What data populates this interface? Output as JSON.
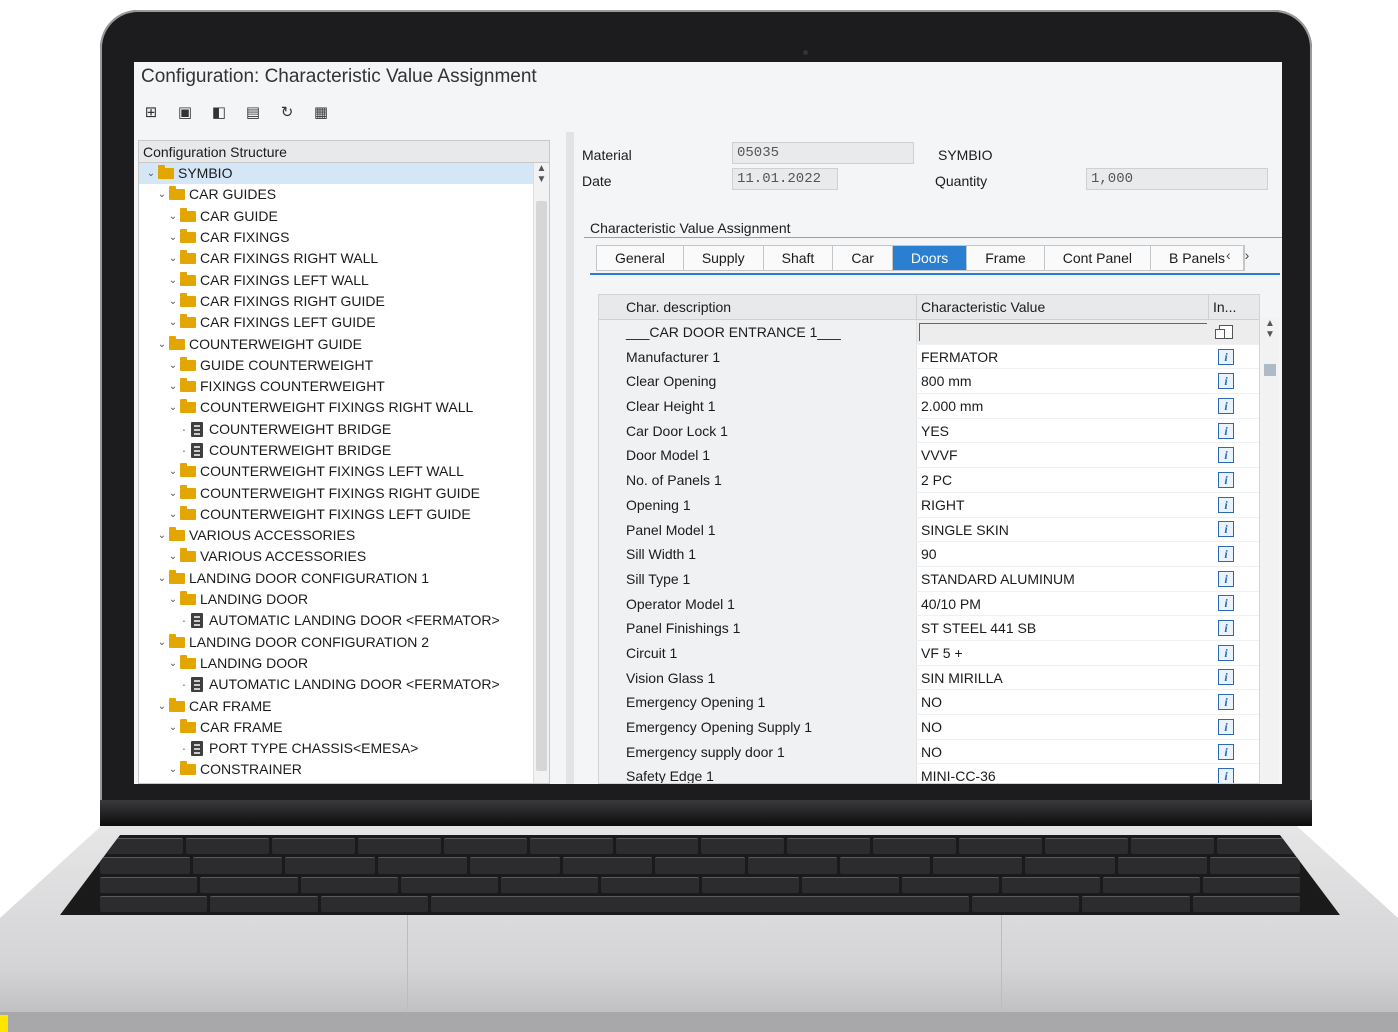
{
  "window": {
    "title": "Configuration: Characteristic Value Assignment"
  },
  "toolbar": {
    "buttons": [
      {
        "name": "tree-view-icon",
        "glyph": "⊞"
      },
      {
        "name": "save-config-icon",
        "glyph": "▣"
      },
      {
        "name": "copy-object-icon",
        "glyph": "◧"
      },
      {
        "name": "price-icon",
        "glyph": "▤"
      },
      {
        "name": "undo-icon",
        "glyph": "↻"
      },
      {
        "name": "calculator-icon",
        "glyph": "▦"
      }
    ]
  },
  "tree": {
    "header": "Configuration Structure",
    "nodes": [
      {
        "label": "SYMBIO",
        "level": 0,
        "type": "folder",
        "selected": true
      },
      {
        "label": "CAR GUIDES",
        "level": 1,
        "type": "folder"
      },
      {
        "label": "CAR GUIDE",
        "level": 2,
        "type": "folder"
      },
      {
        "label": "CAR FIXINGS",
        "level": 2,
        "type": "folder"
      },
      {
        "label": "CAR FIXINGS RIGHT WALL",
        "level": 2,
        "type": "folder"
      },
      {
        "label": "CAR FIXINGS LEFT WALL",
        "level": 2,
        "type": "folder"
      },
      {
        "label": "CAR FIXINGS RIGHT GUIDE",
        "level": 2,
        "type": "folder"
      },
      {
        "label": "CAR FIXINGS LEFT GUIDE",
        "level": 2,
        "type": "folder"
      },
      {
        "label": "COUNTERWEIGHT GUIDE",
        "level": 1,
        "type": "folder"
      },
      {
        "label": "GUIDE COUNTERWEIGHT",
        "level": 2,
        "type": "folder"
      },
      {
        "label": "FIXINGS COUNTERWEIGHT",
        "level": 2,
        "type": "folder"
      },
      {
        "label": "COUNTERWEIGHT FIXINGS RIGHT WALL",
        "level": 2,
        "type": "folder"
      },
      {
        "label": "COUNTERWEIGHT BRIDGE",
        "level": 3,
        "type": "item"
      },
      {
        "label": "COUNTERWEIGHT BRIDGE",
        "level": 3,
        "type": "item"
      },
      {
        "label": "COUNTERWEIGHT FIXINGS LEFT WALL",
        "level": 2,
        "type": "folder"
      },
      {
        "label": "COUNTERWEIGHT FIXINGS RIGHT GUIDE",
        "level": 2,
        "type": "folder"
      },
      {
        "label": "COUNTERWEIGHT FIXINGS LEFT GUIDE",
        "level": 2,
        "type": "folder"
      },
      {
        "label": "VARIOUS ACCESSORIES",
        "level": 1,
        "type": "folder"
      },
      {
        "label": "VARIOUS ACCESSORIES",
        "level": 2,
        "type": "folder"
      },
      {
        "label": "LANDING DOOR CONFIGURATION 1",
        "level": 1,
        "type": "folder"
      },
      {
        "label": "LANDING DOOR",
        "level": 2,
        "type": "folder"
      },
      {
        "label": "AUTOMATIC LANDING DOOR <FERMATOR>",
        "level": 3,
        "type": "item"
      },
      {
        "label": "LANDING DOOR CONFIGURATION 2",
        "level": 1,
        "type": "folder"
      },
      {
        "label": "LANDING DOOR",
        "level": 2,
        "type": "folder"
      },
      {
        "label": "AUTOMATIC LANDING DOOR <FERMATOR>",
        "level": 3,
        "type": "item"
      },
      {
        "label": "CAR FRAME",
        "level": 1,
        "type": "folder"
      },
      {
        "label": "CAR FRAME",
        "level": 2,
        "type": "folder"
      },
      {
        "label": "PORT TYPE CHASSIS<EMESA>",
        "level": 3,
        "type": "item"
      },
      {
        "label": "CONSTRAINER",
        "level": 2,
        "type": "folder"
      }
    ]
  },
  "header": {
    "material_label": "Material",
    "material_value": "05035",
    "material_desc": "SYMBIO",
    "date_label": "Date",
    "date_value": "11.01.2022",
    "quantity_label": "Quantity",
    "quantity_value": "1,000"
  },
  "assignment": {
    "title": "Characteristic Value Assignment",
    "tabs": [
      {
        "label": "General"
      },
      {
        "label": "Supply"
      },
      {
        "label": "Shaft"
      },
      {
        "label": "Car"
      },
      {
        "label": "Doors",
        "active": true
      },
      {
        "label": "Frame"
      },
      {
        "label": "Cont Panel"
      },
      {
        "label": "B Panels"
      }
    ],
    "columns": {
      "desc": "Char. description",
      "value": "Characteristic Value",
      "info": "In..."
    },
    "rows": [
      {
        "desc": "___CAR DOOR ENTRANCE 1___",
        "value": "",
        "separator": true
      },
      {
        "desc": "Manufacturer 1",
        "value": "FERMATOR"
      },
      {
        "desc": "Clear Opening",
        "value": "800 mm"
      },
      {
        "desc": "Clear Height 1",
        "value": "2.000 mm"
      },
      {
        "desc": "Car Door Lock 1",
        "value": "YES"
      },
      {
        "desc": "Door Model 1",
        "value": "VVVF"
      },
      {
        "desc": "No. of Panels 1",
        "value": "2 PC"
      },
      {
        "desc": "Opening 1",
        "value": "RIGHT"
      },
      {
        "desc": "Panel Model 1",
        "value": "SINGLE SKIN"
      },
      {
        "desc": "Sill Width 1",
        "value": "90"
      },
      {
        "desc": "Sill Type 1",
        "value": "STANDARD ALUMINUM"
      },
      {
        "desc": "Operator Model 1",
        "value": "40/10 PM"
      },
      {
        "desc": "Panel Finishings 1",
        "value": "ST STEEL 441 SB"
      },
      {
        "desc": "Circuit 1",
        "value": "VF 5 +"
      },
      {
        "desc": "Vision Glass 1",
        "value": "SIN MIRILLA"
      },
      {
        "desc": "Emergency Opening 1",
        "value": "NO"
      },
      {
        "desc": "Emergency Opening Supply 1",
        "value": "NO"
      },
      {
        "desc": "Emergency supply door 1",
        "value": "NO"
      },
      {
        "desc": "Safety Edge 1",
        "value": "MINI-CC-36"
      }
    ]
  },
  "colors": {
    "accent": "#2b7fd0",
    "folder": "#e3a500",
    "selection": "#d5e6f7"
  }
}
